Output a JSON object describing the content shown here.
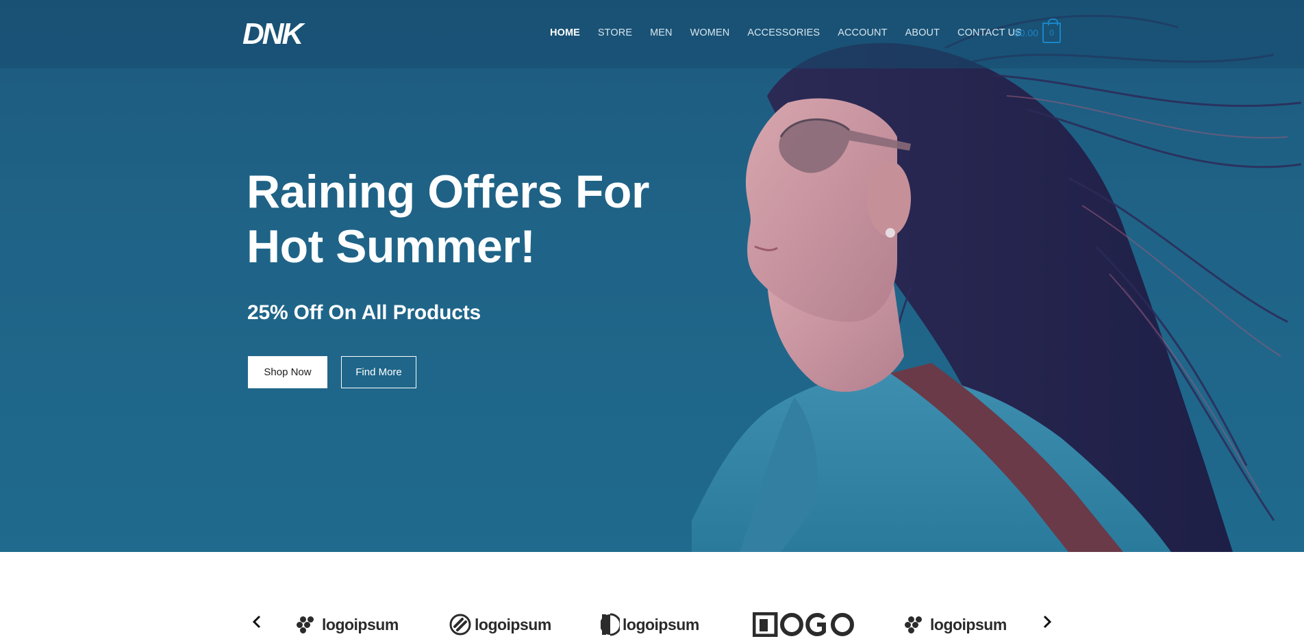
{
  "brand": {
    "logo_text": "DNK"
  },
  "nav": {
    "items": [
      {
        "label": "HOME",
        "active": true
      },
      {
        "label": "STORE"
      },
      {
        "label": "MEN"
      },
      {
        "label": "WOMEN"
      },
      {
        "label": "ACCESSORIES"
      },
      {
        "label": "ACCOUNT"
      },
      {
        "label": "ABOUT"
      },
      {
        "label": "CONTACT US"
      }
    ]
  },
  "cart": {
    "total": "$0.00",
    "count": "0"
  },
  "hero": {
    "title_line1": "Raining Offers For",
    "title_line2": "Hot Summer!",
    "subtitle": "25% Off On All Products",
    "primary_button": "Shop Now",
    "secondary_button": "Find More"
  },
  "logos": {
    "items": [
      {
        "name": "logoipsum",
        "icon": "flower-mark-icon"
      },
      {
        "name": "logoipsum",
        "icon": "circle-slash-icon"
      },
      {
        "name": "logoipsum",
        "icon": "half-circle-icon"
      },
      {
        "name": "LOGO",
        "icon": "logo-wordmark"
      },
      {
        "name": "logoipsum",
        "icon": "flower-mark-icon"
      }
    ]
  },
  "colors": {
    "hero_background": "#1e6287",
    "accent": "#1a86c8",
    "text_light": "#ffffff"
  }
}
